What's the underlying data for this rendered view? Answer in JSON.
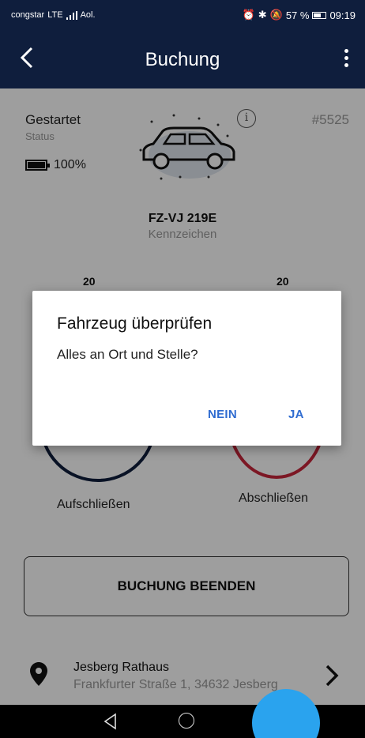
{
  "status_bar": {
    "carrier": "congstar",
    "network": "LTE",
    "extra": "Aol.",
    "battery": "57 %",
    "time": "09:19"
  },
  "app_bar": {
    "title": "Buchung",
    "back_icon": "chevron-left-icon",
    "menu_icon": "more-vert-icon"
  },
  "booking": {
    "status": "Gestartet",
    "status_label": "Status",
    "battery": "100%",
    "id": "#5525",
    "plate": "FZ-VJ 219E",
    "plate_label": "Kennzeichen",
    "count_left": "20",
    "count_right": "20",
    "unlock_label": "Aufschließen",
    "lock_label": "Abschließen",
    "end_button": "BUCHUNG BEENDEN"
  },
  "location": {
    "name": "Jesberg Rathaus",
    "address": "Frankfurter Straße 1, 34632 Jesberg"
  },
  "dialog": {
    "title": "Fahrzeug überprüfen",
    "message": "Alles an Ort und Stelle?",
    "no_label": "NEIN",
    "yes_label": "JA"
  },
  "colors": {
    "primary": "#0f1e3d",
    "accent": "#2e6bd0",
    "lock": "#c8263a",
    "fab": "#2aa3ee"
  }
}
